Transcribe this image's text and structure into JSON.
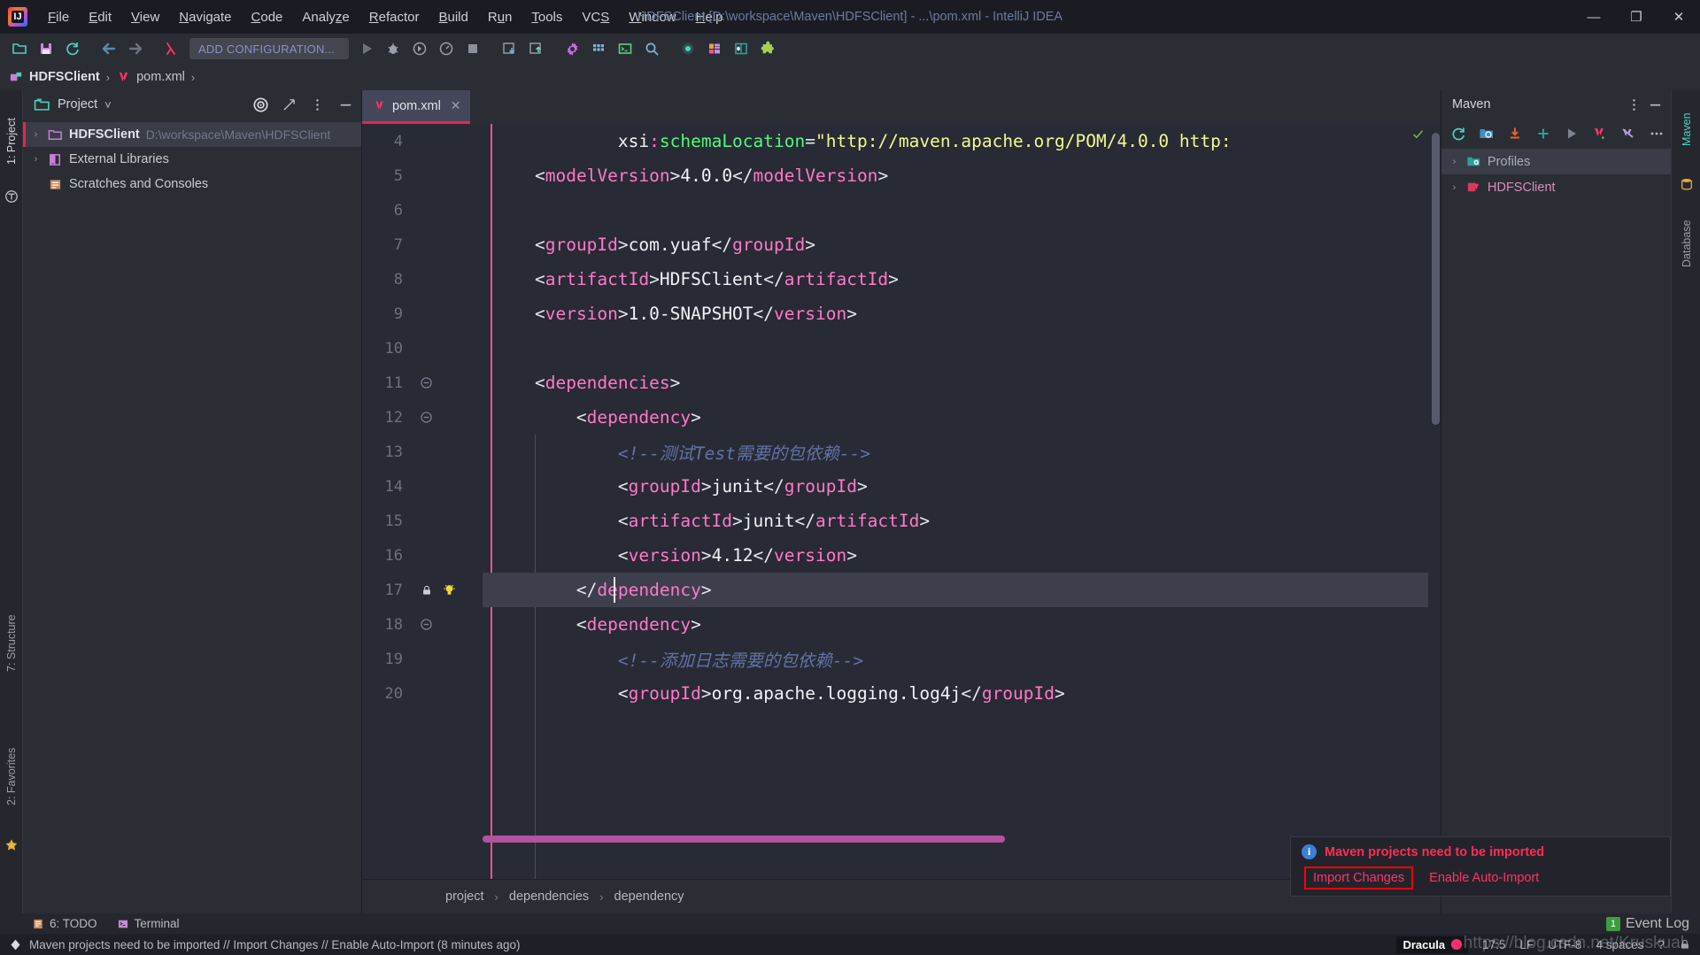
{
  "window": {
    "title": "HDFSClient [D:\\workspace\\Maven\\HDFSClient] - ...\\pom.xml - IntelliJ IDEA",
    "minimize": "—",
    "maximize": "❐",
    "close": "✕",
    "logo_text": "IJ"
  },
  "menu": [
    {
      "label": "File",
      "mnemonic": "F"
    },
    {
      "label": "Edit",
      "mnemonic": "E"
    },
    {
      "label": "View",
      "mnemonic": "V"
    },
    {
      "label": "Navigate",
      "mnemonic": "N"
    },
    {
      "label": "Code",
      "mnemonic": "C"
    },
    {
      "label": "Analyze",
      "mnemonic": "z"
    },
    {
      "label": "Refactor",
      "mnemonic": "R"
    },
    {
      "label": "Build",
      "mnemonic": "B"
    },
    {
      "label": "Run",
      "mnemonic": "u"
    },
    {
      "label": "Tools",
      "mnemonic": "T"
    },
    {
      "label": "VCS",
      "mnemonic": "S"
    },
    {
      "label": "Window",
      "mnemonic": "W"
    },
    {
      "label": "Help",
      "mnemonic": "H"
    }
  ],
  "toolbar": {
    "run_configuration": "ADD CONFIGURATION...",
    "icons": [
      "open-project-icon",
      "save-all-icon",
      "sync-icon",
      "back-icon",
      "forward-icon",
      "lambda-icon",
      "run-icon",
      "debug-icon",
      "run-with-coverage-icon",
      "profiler-icon",
      "stop-icon",
      "update-project-icon",
      "commit-icon",
      "settings-gear-icon",
      "project-structure-icon",
      "terminal-icon",
      "search-everywhere-icon",
      "record-icon",
      "layout-icon",
      "database-icon",
      "plugin-icon"
    ]
  },
  "navbar": {
    "project": "HDFSClient",
    "file": "pom.xml"
  },
  "left_stripe": {
    "tools": [
      "1: Project",
      "7: Structure",
      "2: Favorites"
    ]
  },
  "right_stripe": {
    "tools": [
      "Maven",
      "Database"
    ]
  },
  "project_panel": {
    "title": "Project",
    "dropdown": "˅",
    "actions": [
      "locate-target-icon",
      "collapse-all-icon",
      "options-menu-icon",
      "hide-icon"
    ],
    "tree": [
      {
        "label": "HDFSClient",
        "path": "D:\\workspace\\Maven\\HDFSClient",
        "icon": "folder-icon",
        "selected": true,
        "arrow": "›"
      },
      {
        "label": "External Libraries",
        "path": "",
        "icon": "library-icon",
        "selected": false,
        "arrow": "›"
      },
      {
        "label": "Scratches and Consoles",
        "path": "",
        "icon": "scratch-icon",
        "selected": false,
        "arrow": ""
      }
    ]
  },
  "editor": {
    "tab": {
      "label": "pom.xml",
      "icon": "maven-xml-icon",
      "close": "✕"
    },
    "lines": [
      {
        "num": "4",
        "indent": 0,
        "fold": "",
        "bulb": false,
        "highlight": false,
        "tokens": [
          {
            "t": "            ",
            "c": "t-txt"
          },
          {
            "t": "xsi",
            "c": "t-txt"
          },
          {
            "t": ":",
            "c": "t-tag"
          },
          {
            "t": "schemaLocation",
            "c": "t-attr"
          },
          {
            "t": "=",
            "c": "t-brk"
          },
          {
            "t": "\"http://maven.apache.org/POM/4.0.0 http:",
            "c": "t-str"
          }
        ]
      },
      {
        "num": "5",
        "indent": 0,
        "fold": "",
        "bulb": false,
        "highlight": false,
        "tokens": [
          {
            "t": "    ",
            "c": "t-txt"
          },
          {
            "t": "<",
            "c": "t-brk"
          },
          {
            "t": "modelVersion",
            "c": "t-tag"
          },
          {
            "t": ">",
            "c": "t-brk"
          },
          {
            "t": "4.0.0",
            "c": "t-txt"
          },
          {
            "t": "</",
            "c": "t-brk"
          },
          {
            "t": "modelVersion",
            "c": "t-tag"
          },
          {
            "t": ">",
            "c": "t-brk"
          }
        ]
      },
      {
        "num": "6",
        "indent": 0,
        "fold": "",
        "bulb": false,
        "highlight": false,
        "tokens": []
      },
      {
        "num": "7",
        "indent": 0,
        "fold": "",
        "bulb": false,
        "highlight": false,
        "tokens": [
          {
            "t": "    ",
            "c": "t-txt"
          },
          {
            "t": "<",
            "c": "t-brk"
          },
          {
            "t": "groupId",
            "c": "t-tag"
          },
          {
            "t": ">",
            "c": "t-brk"
          },
          {
            "t": "com.yuaf",
            "c": "t-txt"
          },
          {
            "t": "</",
            "c": "t-brk"
          },
          {
            "t": "groupId",
            "c": "t-tag"
          },
          {
            "t": ">",
            "c": "t-brk"
          }
        ]
      },
      {
        "num": "8",
        "indent": 0,
        "fold": "",
        "bulb": false,
        "highlight": false,
        "tokens": [
          {
            "t": "    ",
            "c": "t-txt"
          },
          {
            "t": "<",
            "c": "t-brk"
          },
          {
            "t": "artifactId",
            "c": "t-tag"
          },
          {
            "t": ">",
            "c": "t-brk"
          },
          {
            "t": "HDFSClient",
            "c": "t-txt"
          },
          {
            "t": "</",
            "c": "t-brk"
          },
          {
            "t": "artifactId",
            "c": "t-tag"
          },
          {
            "t": ">",
            "c": "t-brk"
          }
        ]
      },
      {
        "num": "9",
        "indent": 0,
        "fold": "",
        "bulb": false,
        "highlight": false,
        "tokens": [
          {
            "t": "    ",
            "c": "t-txt"
          },
          {
            "t": "<",
            "c": "t-brk"
          },
          {
            "t": "version",
            "c": "t-tag"
          },
          {
            "t": ">",
            "c": "t-brk"
          },
          {
            "t": "1.0-SNAPSHOT",
            "c": "t-txt"
          },
          {
            "t": "</",
            "c": "t-brk"
          },
          {
            "t": "version",
            "c": "t-tag"
          },
          {
            "t": ">",
            "c": "t-brk"
          }
        ]
      },
      {
        "num": "10",
        "indent": 0,
        "fold": "",
        "bulb": false,
        "highlight": false,
        "tokens": []
      },
      {
        "num": "11",
        "indent": 0,
        "fold": "minus",
        "bulb": false,
        "highlight": false,
        "tokens": [
          {
            "t": "    ",
            "c": "t-txt"
          },
          {
            "t": "<",
            "c": "t-brk"
          },
          {
            "t": "dependencies",
            "c": "t-tag"
          },
          {
            "t": ">",
            "c": "t-brk"
          }
        ]
      },
      {
        "num": "12",
        "indent": 0,
        "fold": "minus",
        "bulb": false,
        "highlight": false,
        "tokens": [
          {
            "t": "        ",
            "c": "t-txt"
          },
          {
            "t": "<",
            "c": "t-brk"
          },
          {
            "t": "dependency",
            "c": "t-tag"
          },
          {
            "t": ">",
            "c": "t-brk"
          }
        ]
      },
      {
        "num": "13",
        "indent": 0,
        "fold": "",
        "bulb": false,
        "highlight": false,
        "tokens": [
          {
            "t": "            ",
            "c": "t-txt"
          },
          {
            "t": "<!--测试Test需要的包依赖-->",
            "c": "t-cmt"
          }
        ]
      },
      {
        "num": "14",
        "indent": 0,
        "fold": "",
        "bulb": false,
        "highlight": false,
        "tokens": [
          {
            "t": "            ",
            "c": "t-txt"
          },
          {
            "t": "<",
            "c": "t-brk"
          },
          {
            "t": "groupId",
            "c": "t-tag"
          },
          {
            "t": ">",
            "c": "t-brk"
          },
          {
            "t": "junit",
            "c": "t-txt"
          },
          {
            "t": "</",
            "c": "t-brk"
          },
          {
            "t": "groupId",
            "c": "t-tag"
          },
          {
            "t": ">",
            "c": "t-brk"
          }
        ]
      },
      {
        "num": "15",
        "indent": 0,
        "fold": "",
        "bulb": false,
        "highlight": false,
        "tokens": [
          {
            "t": "            ",
            "c": "t-txt"
          },
          {
            "t": "<",
            "c": "t-brk"
          },
          {
            "t": "artifactId",
            "c": "t-tag"
          },
          {
            "t": ">",
            "c": "t-brk"
          },
          {
            "t": "junit",
            "c": "t-txt"
          },
          {
            "t": "</",
            "c": "t-brk"
          },
          {
            "t": "artifactId",
            "c": "t-tag"
          },
          {
            "t": ">",
            "c": "t-brk"
          }
        ]
      },
      {
        "num": "16",
        "indent": 0,
        "fold": "",
        "bulb": false,
        "highlight": false,
        "tokens": [
          {
            "t": "            ",
            "c": "t-txt"
          },
          {
            "t": "<",
            "c": "t-brk"
          },
          {
            "t": "version",
            "c": "t-tag"
          },
          {
            "t": ">",
            "c": "t-brk"
          },
          {
            "t": "4.12",
            "c": "t-txt"
          },
          {
            "t": "</",
            "c": "t-brk"
          },
          {
            "t": "version",
            "c": "t-tag"
          },
          {
            "t": ">",
            "c": "t-brk"
          }
        ]
      },
      {
        "num": "17",
        "indent": 0,
        "fold": "",
        "bulb": true,
        "highlight": true,
        "tokens": [
          {
            "t": "        ",
            "c": "t-txt"
          },
          {
            "t": "</",
            "c": "t-brk"
          },
          {
            "t": "dependency",
            "c": "t-tag"
          },
          {
            "t": ">",
            "c": "t-brk"
          }
        ]
      },
      {
        "num": "18",
        "indent": 0,
        "fold": "minus",
        "bulb": false,
        "highlight": false,
        "tokens": [
          {
            "t": "        ",
            "c": "t-txt"
          },
          {
            "t": "<",
            "c": "t-brk"
          },
          {
            "t": "dependency",
            "c": "t-tag"
          },
          {
            "t": ">",
            "c": "t-brk"
          }
        ]
      },
      {
        "num": "19",
        "indent": 0,
        "fold": "",
        "bulb": false,
        "highlight": false,
        "tokens": [
          {
            "t": "            ",
            "c": "t-txt"
          },
          {
            "t": "<!--添加日志需要的包依赖-->",
            "c": "t-cmt"
          }
        ]
      },
      {
        "num": "20",
        "indent": 0,
        "fold": "",
        "bulb": false,
        "highlight": false,
        "tokens": [
          {
            "t": "            ",
            "c": "t-txt"
          },
          {
            "t": "<",
            "c": "t-brk"
          },
          {
            "t": "groupId",
            "c": "t-tag"
          },
          {
            "t": ">",
            "c": "t-brk"
          },
          {
            "t": "org.apache.logging.log4j",
            "c": "t-txt"
          },
          {
            "t": "</",
            "c": "t-brk"
          },
          {
            "t": "groupId",
            "c": "t-tag"
          },
          {
            "t": ">",
            "c": "t-brk"
          }
        ]
      }
    ],
    "breadcrumbs": [
      "project",
      "dependencies",
      "dependency"
    ],
    "breadcrumb_sep": "›"
  },
  "maven_panel": {
    "title": "Maven",
    "actions": [
      "reimport-icon",
      "generate-sources-icon",
      "download-sources-icon",
      "add-icon",
      "run-maven-build-icon",
      "toggle-offline-icon",
      "skip-tests-icon",
      "more-icon"
    ],
    "tree": [
      {
        "label": "Profiles",
        "icon": "profiles-folder-icon",
        "selected": true,
        "arrow": "›"
      },
      {
        "label": "HDFSClient",
        "icon": "maven-project-icon",
        "selected": false,
        "arrow": "›"
      }
    ]
  },
  "notification": {
    "info_glyph": "i",
    "title": "Maven projects need to be imported",
    "primary_action": "Import Changes",
    "secondary_action": "Enable Auto-Import"
  },
  "bottom_strip": {
    "items": [
      {
        "label": "6: TODO",
        "mnemonic": "6",
        "icon": "todo-icon"
      },
      {
        "label": "Terminal",
        "mnemonic": "",
        "icon": "terminal-icon"
      }
    ],
    "event_log": {
      "label": "Event Log",
      "count": "1"
    }
  },
  "statusbar": {
    "message": "Maven projects need to be imported // Import Changes // Enable Auto-Import (8 minutes ago)",
    "theme": "Dracula",
    "caret": "17:5",
    "line_separator": "LF",
    "encoding": "UTF-8",
    "indent": "4 spaces",
    "branch": "?",
    "lock_icon": "read-only-icon"
  },
  "watermark": "https://blog.csdn.net/Kruskual",
  "colors": {
    "accent_pink": "#ff2d6f",
    "tab_underline": "#e8254f",
    "selection_bg": "#3a3d47",
    "editor_bg": "#282a36",
    "panel_bg": "#2b2d35",
    "string": "#f1fa8c",
    "tag": "#ff79c6",
    "attr": "#50fa7b",
    "comment": "#6272a4"
  }
}
